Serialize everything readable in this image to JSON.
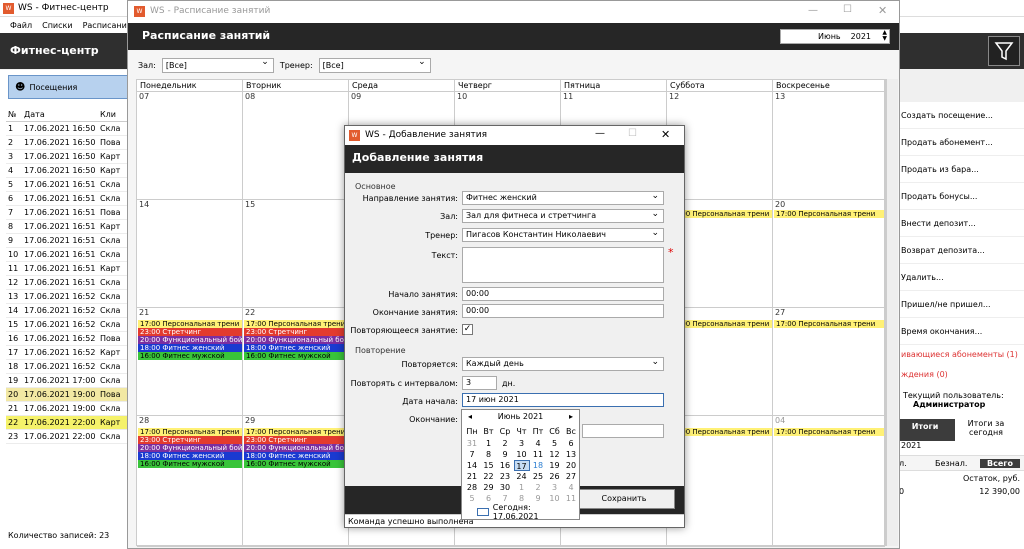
{
  "main": {
    "title": "WS - Фитнес-центр",
    "menu": [
      "Файл",
      "Списки",
      "Расписание"
    ],
    "header": "Фитнес-центр",
    "visits_button": "Посещения",
    "table_headers": [
      "№",
      "Дата",
      "Кли"
    ],
    "rows": [
      [
        "1",
        "17.06.2021 16:50",
        "Скла"
      ],
      [
        "2",
        "17.06.2021 16:50",
        "Пова"
      ],
      [
        "3",
        "17.06.2021 16:50",
        "Карт"
      ],
      [
        "4",
        "17.06.2021 16:50",
        "Карт"
      ],
      [
        "5",
        "17.06.2021 16:51",
        "Скла"
      ],
      [
        "6",
        "17.06.2021 16:51",
        "Скла"
      ],
      [
        "7",
        "17.06.2021 16:51",
        "Пова"
      ],
      [
        "8",
        "17.06.2021 16:51",
        "Карт"
      ],
      [
        "9",
        "17.06.2021 16:51",
        "Скла"
      ],
      [
        "10",
        "17.06.2021 16:51",
        "Скла"
      ],
      [
        "11",
        "17.06.2021 16:51",
        "Карт"
      ],
      [
        "12",
        "17.06.2021 16:51",
        "Скла"
      ],
      [
        "13",
        "17.06.2021 16:52",
        "Скла"
      ],
      [
        "14",
        "17.06.2021 16:52",
        "Скла"
      ],
      [
        "15",
        "17.06.2021 16:52",
        "Скла"
      ],
      [
        "16",
        "17.06.2021 16:52",
        "Пова"
      ],
      [
        "17",
        "17.06.2021 16:52",
        "Карт"
      ],
      [
        "18",
        "17.06.2021 16:52",
        "Скла"
      ],
      [
        "19",
        "17.06.2021 17:00",
        "Скла"
      ],
      [
        "20",
        "17.06.2021 19:00",
        "Пова"
      ],
      [
        "21",
        "17.06.2021 19:00",
        "Скла"
      ],
      [
        "22",
        "17.06.2021 22:00",
        "Карт"
      ],
      [
        "23",
        "17.06.2021 22:00",
        "Скла"
      ]
    ],
    "count": "Количество записей: 23",
    "right_actions": [
      "Создать посещение...",
      "Продать абонемент...",
      "Продать из бара...",
      "Продать бонусы...",
      "Внести депозит...",
      "Возврат депозита...",
      "Удалить...",
      "Пришел/не пришел...",
      "Время окончания..."
    ],
    "right_red": [
      "ивающиеся абонементы (1)",
      "ждения (0)"
    ],
    "user_label": "Текущий пользователь:",
    "user_name": "Администратор",
    "totals_tab": "Итоги",
    "totals_today": "Итоги за сегодня",
    "totals_date": "2021",
    "cols": [
      "л.",
      "Безнал.",
      "Всего"
    ],
    "balance_label": "Остаток, руб.",
    "balance_value": "12 390,00",
    "row_zero": "0"
  },
  "schedule": {
    "title": "WS - Расписание занятий",
    "header": "Расписание занятий",
    "month": "Июнь",
    "year": "2021",
    "hall_label": "Зал:",
    "hall_value": "[Все]",
    "trainer_label": "Тренер:",
    "trainer_value": "[Все]",
    "days": [
      "Понедельник",
      "Вторник",
      "Среда",
      "Четверг",
      "Пятница",
      "Суббота",
      "Воскресенье"
    ],
    "weeks": [
      [
        "07",
        "08",
        "09",
        "10",
        "11",
        "12",
        "13"
      ],
      [
        "14",
        "15",
        "",
        "",
        "",
        "",
        "20"
      ],
      [
        "21",
        "22",
        "",
        "",
        "",
        "",
        "27"
      ],
      [
        "28",
        "29",
        "",
        "",
        "",
        "",
        "04"
      ]
    ],
    "events": {
      "personal": "17:00 Персональная трени",
      "stretch": "23:00 Стретчинг",
      "functional": "20:00 Функциональный бой",
      "female": "18:00 Фитнес женский",
      "male": "16:00 Фитнес мужской"
    }
  },
  "dialog": {
    "title": "WS - Добавление занятия",
    "header": "Добавление занятия",
    "section_main": "Основное",
    "direction_label": "Направление занятия:",
    "direction_value": "Фитнес женский",
    "hall_label": "Зал:",
    "hall_value": "Зал для фитнеса и стретчинга",
    "trainer_label": "Тренер:",
    "trainer_value": "Пигасов Константин Николаевич",
    "text_label": "Текст:",
    "start_label": "Начало занятия:",
    "start_value": "00:00",
    "end_label": "Окончание занятия:",
    "end_value": "00:00",
    "repeat_label": "Повторяющееся занятие:",
    "section_repeat": "Повторение",
    "repeats_label": "Повторяется:",
    "repeats_value": "Каждый день",
    "interval_label": "Повторять с интервалом:",
    "interval_value": "3",
    "interval_unit": "дн.",
    "date_start_label": "Дата начала:",
    "date_start_value": "17 июн 2021",
    "end_label2": "Окончание:",
    "save": "Сохранить",
    "status": "Команда успешно выполнена"
  },
  "popup": {
    "month": "Июнь 2021",
    "weekdays": [
      "Пн",
      "Вт",
      "Ср",
      "Чт",
      "Пт",
      "Сб",
      "Вс"
    ],
    "days": [
      [
        "31",
        "1",
        "2",
        "3",
        "4",
        "5",
        "6"
      ],
      [
        "7",
        "8",
        "9",
        "10",
        "11",
        "12",
        "13"
      ],
      [
        "14",
        "15",
        "16",
        "17",
        "18",
        "19",
        "20"
      ],
      [
        "21",
        "22",
        "23",
        "24",
        "25",
        "26",
        "27"
      ],
      [
        "28",
        "29",
        "30",
        "1",
        "2",
        "3",
        "4"
      ],
      [
        "5",
        "6",
        "7",
        "8",
        "9",
        "10",
        "11"
      ]
    ],
    "today": "Сегодня: 17.06.2021"
  }
}
